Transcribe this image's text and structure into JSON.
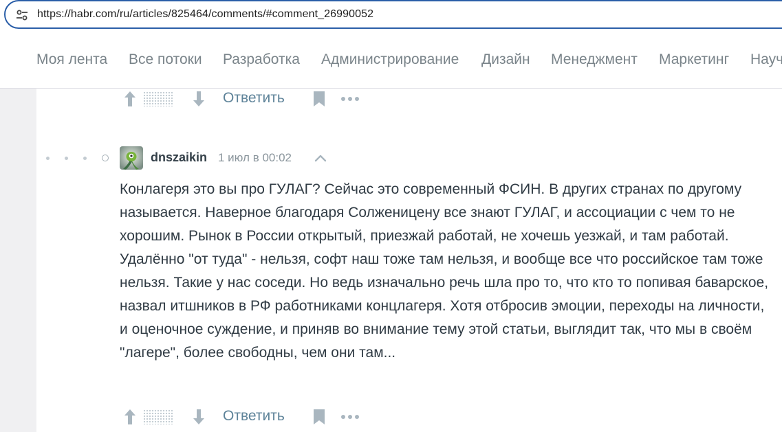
{
  "browser": {
    "url": "https://habr.com/ru/articles/825464/comments/#comment_26990052",
    "site_info_icon": "tune-icon"
  },
  "nav": {
    "hubs": [
      "Моя лента",
      "Все потоки",
      "Разработка",
      "Администрирование",
      "Дизайн",
      "Менеджмент",
      "Маркетинг",
      "Науч"
    ]
  },
  "prev_comment": {
    "reply_label": "Ответить"
  },
  "comment": {
    "author": "dnszaikin",
    "datetime": "1 июл в 00:02",
    "body": "Конлагеря это вы про ГУЛАГ? Сейчас это современный ФСИН. В других странах по другому называется. Наверное благодаря Солженицену все знают ГУЛАГ, и ассоциации с чем то не хорошим. Рынок в России открытый, приезжай работай, не хочешь уезжай, и там работай. Удалённо \"от туда\" - нельзя, софт наш тоже там нельзя, и вообще все что российское там тоже нельзя. Такие у нас соседи. Но ведь изначально речь шла про то, что кто то попивая баварское, назвал итшников в РФ работниками концлагеря. Хотя отбросив эмоции, переходы на личности, и оценочное суждение, и приняв во внимание тему этой статьи, выглядит так, что мы в своём \"лагере\", более свободны, чем они там...",
    "reply_label": "Ответить"
  },
  "icons": {
    "vote_up": "arrow-up-icon",
    "vote_down": "arrow-down-icon",
    "bookmark": "bookmark-icon",
    "more": "more-icon",
    "parent": "chevron-up-icon"
  },
  "colors": {
    "accent_link": "#5e8399",
    "url_border": "#2a5ea8",
    "page_bg": "#f0f0f2"
  }
}
